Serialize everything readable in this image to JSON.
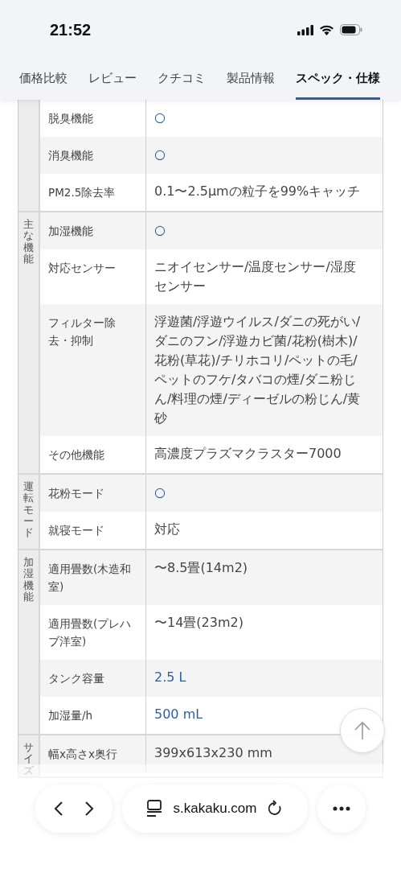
{
  "status_bar": {
    "time": "21:52"
  },
  "tabs": [
    {
      "label": "価格比較",
      "selected": false
    },
    {
      "label": "レビュー",
      "selected": false
    },
    {
      "label": "クチコミ",
      "selected": false
    },
    {
      "label": "製品情報",
      "selected": false
    },
    {
      "label": "スペック・仕様",
      "selected": true
    }
  ],
  "spec_groups": [
    {
      "rows": [
        {
          "label": "脱臭機能",
          "value": "○",
          "kind": "mark"
        },
        {
          "label": "消臭機能",
          "value": "○",
          "kind": "mark"
        },
        {
          "label": "PM2.5除去率",
          "value": "0.1〜2.5µmの粒子を99%キャッチ",
          "kind": "text"
        }
      ]
    },
    {
      "group": "主な機能",
      "rows": [
        {
          "label": "加湿機能",
          "value": "○",
          "kind": "mark"
        },
        {
          "label": "対応センサー",
          "value": "ニオイセンサー/温度センサー/湿度センサー",
          "kind": "text"
        },
        {
          "label": "フィルター除去・抑制",
          "value": "浮遊菌/浮遊ウイルス/ダニの死がい/ダニのフン/浮遊カビ菌/花粉(樹木)/花粉(草花)/チリホコリ/ペットの毛/ペットのフケ/タバコの煙/ダニ粉じん/料理の煙/ディーゼルの粉じん/黄砂",
          "kind": "text"
        },
        {
          "label": "その他機能",
          "value": "高濃度プラズマクラスター7000",
          "kind": "text"
        }
      ]
    },
    {
      "group": "運転モード",
      "rows": [
        {
          "label": "花粉モード",
          "value": "○",
          "kind": "mark"
        },
        {
          "label": "就寝モード",
          "value": "対応",
          "kind": "text"
        }
      ]
    },
    {
      "group": "加湿機能",
      "rows": [
        {
          "label": "適用畳数(木造和室)",
          "value": "〜8.5畳(14m2)",
          "kind": "text"
        },
        {
          "label": "適用畳数(プレハブ洋室)",
          "value": "〜14畳(23m2)",
          "kind": "text"
        },
        {
          "label": "タンク容量",
          "value": "2.5 L",
          "kind": "link"
        },
        {
          "label": "加湿量/h",
          "value": "500 mL",
          "kind": "link"
        }
      ]
    },
    {
      "group": "サイズ",
      "rows": [
        {
          "label": "幅x高さx奥行",
          "value": "399x613x230 mm",
          "kind": "text"
        }
      ]
    }
  ],
  "browser_bar": {
    "url": "s.kakaku.com"
  }
}
